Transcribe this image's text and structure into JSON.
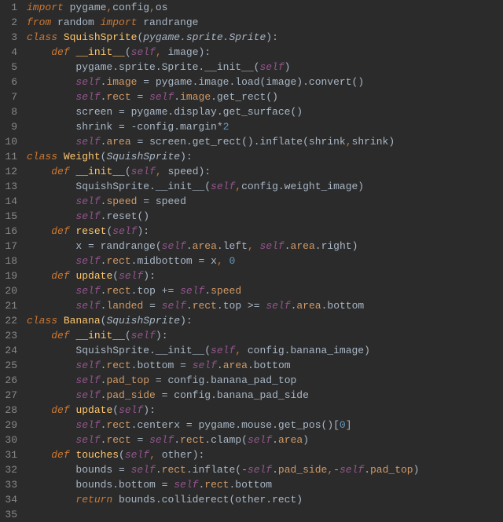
{
  "lines": [
    {
      "n": 1,
      "tokens": [
        {
          "t": "import ",
          "c": "kw"
        },
        {
          "t": "pygame",
          "c": "id"
        },
        {
          "t": ",",
          "c": "comma"
        },
        {
          "t": "config",
          "c": "id"
        },
        {
          "t": ",",
          "c": "comma"
        },
        {
          "t": "os",
          "c": "id"
        }
      ]
    },
    {
      "n": 2,
      "tokens": [
        {
          "t": "from ",
          "c": "kw"
        },
        {
          "t": "random ",
          "c": "id"
        },
        {
          "t": "import ",
          "c": "kw"
        },
        {
          "t": "randrange",
          "c": "id"
        }
      ]
    },
    {
      "n": 3,
      "tokens": [
        {
          "t": "class ",
          "c": "kw"
        },
        {
          "t": "SquishSprite",
          "c": "classname"
        },
        {
          "t": "(",
          "c": "paren"
        },
        {
          "t": "pygame.sprite.Sprite",
          "c": "base"
        },
        {
          "t": "):",
          "c": "paren"
        }
      ]
    },
    {
      "n": 4,
      "tokens": [
        {
          "t": "    ",
          "c": "id"
        },
        {
          "t": "def ",
          "c": "kw"
        },
        {
          "t": "__init__",
          "c": "def"
        },
        {
          "t": "(",
          "c": "paren"
        },
        {
          "t": "self",
          "c": "self"
        },
        {
          "t": ", ",
          "c": "comma"
        },
        {
          "t": "image",
          "c": "id"
        },
        {
          "t": "):",
          "c": "paren"
        }
      ]
    },
    {
      "n": 5,
      "tokens": [
        {
          "t": "        pygame.sprite.Sprite.__init__(",
          "c": "id"
        },
        {
          "t": "self",
          "c": "self"
        },
        {
          "t": ")",
          "c": "paren"
        }
      ]
    },
    {
      "n": 6,
      "tokens": [
        {
          "t": "        ",
          "c": "id"
        },
        {
          "t": "self",
          "c": "self"
        },
        {
          "t": ".",
          "c": "op"
        },
        {
          "t": "image",
          "c": "prop"
        },
        {
          "t": " = pygame.image.load(image).convert()",
          "c": "id"
        }
      ]
    },
    {
      "n": 7,
      "tokens": [
        {
          "t": "        ",
          "c": "id"
        },
        {
          "t": "self",
          "c": "self"
        },
        {
          "t": ".",
          "c": "op"
        },
        {
          "t": "rect",
          "c": "prop"
        },
        {
          "t": " = ",
          "c": "id"
        },
        {
          "t": "self",
          "c": "self"
        },
        {
          "t": ".",
          "c": "op"
        },
        {
          "t": "image",
          "c": "prop"
        },
        {
          "t": ".get_rect()",
          "c": "id"
        }
      ]
    },
    {
      "n": 8,
      "tokens": [
        {
          "t": "        screen = pygame.display.get_surface()",
          "c": "id"
        }
      ]
    },
    {
      "n": 9,
      "tokens": [
        {
          "t": "        shrink = -config.margin*",
          "c": "id"
        },
        {
          "t": "2",
          "c": "num"
        }
      ]
    },
    {
      "n": 10,
      "tokens": [
        {
          "t": "        ",
          "c": "id"
        },
        {
          "t": "self",
          "c": "self"
        },
        {
          "t": ".",
          "c": "op"
        },
        {
          "t": "area",
          "c": "prop"
        },
        {
          "t": " = screen.get_rect().inflate(shrink",
          "c": "id"
        },
        {
          "t": ",",
          "c": "comma"
        },
        {
          "t": "shrink)",
          "c": "id"
        }
      ]
    },
    {
      "n": 11,
      "tokens": [
        {
          "t": "class ",
          "c": "kw"
        },
        {
          "t": "Weight",
          "c": "classname"
        },
        {
          "t": "(",
          "c": "paren"
        },
        {
          "t": "SquishSprite",
          "c": "base"
        },
        {
          "t": "):",
          "c": "paren"
        }
      ]
    },
    {
      "n": 12,
      "tokens": [
        {
          "t": "    ",
          "c": "id"
        },
        {
          "t": "def ",
          "c": "kw"
        },
        {
          "t": "__init__",
          "c": "def"
        },
        {
          "t": "(",
          "c": "paren"
        },
        {
          "t": "self",
          "c": "self"
        },
        {
          "t": ", ",
          "c": "comma"
        },
        {
          "t": "speed",
          "c": "id"
        },
        {
          "t": "):",
          "c": "paren"
        }
      ]
    },
    {
      "n": 13,
      "tokens": [
        {
          "t": "        SquishSprite.__init__(",
          "c": "id"
        },
        {
          "t": "self",
          "c": "self"
        },
        {
          "t": ",",
          "c": "comma"
        },
        {
          "t": "config.weight_image)",
          "c": "id"
        }
      ]
    },
    {
      "n": 14,
      "tokens": [
        {
          "t": "        ",
          "c": "id"
        },
        {
          "t": "self",
          "c": "self"
        },
        {
          "t": ".",
          "c": "op"
        },
        {
          "t": "speed",
          "c": "prop"
        },
        {
          "t": " = speed",
          "c": "id"
        }
      ]
    },
    {
      "n": 15,
      "tokens": [
        {
          "t": "        ",
          "c": "id"
        },
        {
          "t": "self",
          "c": "self"
        },
        {
          "t": ".reset()",
          "c": "id"
        }
      ]
    },
    {
      "n": 16,
      "tokens": [
        {
          "t": "    ",
          "c": "id"
        },
        {
          "t": "def ",
          "c": "kw"
        },
        {
          "t": "reset",
          "c": "def"
        },
        {
          "t": "(",
          "c": "paren"
        },
        {
          "t": "self",
          "c": "self"
        },
        {
          "t": "):",
          "c": "paren"
        }
      ]
    },
    {
      "n": 17,
      "tokens": [
        {
          "t": "        x = randrange(",
          "c": "id"
        },
        {
          "t": "self",
          "c": "self"
        },
        {
          "t": ".",
          "c": "op"
        },
        {
          "t": "area",
          "c": "prop"
        },
        {
          "t": ".left",
          "c": "id"
        },
        {
          "t": ", ",
          "c": "comma"
        },
        {
          "t": "self",
          "c": "self"
        },
        {
          "t": ".",
          "c": "op"
        },
        {
          "t": "area",
          "c": "prop"
        },
        {
          "t": ".right)",
          "c": "id"
        }
      ]
    },
    {
      "n": 18,
      "tokens": [
        {
          "t": "        ",
          "c": "id"
        },
        {
          "t": "self",
          "c": "self"
        },
        {
          "t": ".",
          "c": "op"
        },
        {
          "t": "rect",
          "c": "prop"
        },
        {
          "t": ".midbottom = x",
          "c": "id"
        },
        {
          "t": ", ",
          "c": "comma"
        },
        {
          "t": "0",
          "c": "num"
        }
      ]
    },
    {
      "n": 19,
      "tokens": [
        {
          "t": "    ",
          "c": "id"
        },
        {
          "t": "def ",
          "c": "kw"
        },
        {
          "t": "update",
          "c": "def"
        },
        {
          "t": "(",
          "c": "paren"
        },
        {
          "t": "self",
          "c": "self"
        },
        {
          "t": "):",
          "c": "paren"
        }
      ]
    },
    {
      "n": 20,
      "tokens": [
        {
          "t": "        ",
          "c": "id"
        },
        {
          "t": "self",
          "c": "self"
        },
        {
          "t": ".",
          "c": "op"
        },
        {
          "t": "rect",
          "c": "prop"
        },
        {
          "t": ".top += ",
          "c": "id"
        },
        {
          "t": "self",
          "c": "self"
        },
        {
          "t": ".",
          "c": "op"
        },
        {
          "t": "speed",
          "c": "prop"
        }
      ]
    },
    {
      "n": 21,
      "tokens": [
        {
          "t": "        ",
          "c": "id"
        },
        {
          "t": "self",
          "c": "self"
        },
        {
          "t": ".",
          "c": "op"
        },
        {
          "t": "landed",
          "c": "prop"
        },
        {
          "t": " = ",
          "c": "id"
        },
        {
          "t": "self",
          "c": "self"
        },
        {
          "t": ".",
          "c": "op"
        },
        {
          "t": "rect",
          "c": "prop"
        },
        {
          "t": ".top >= ",
          "c": "id"
        },
        {
          "t": "self",
          "c": "self"
        },
        {
          "t": ".",
          "c": "op"
        },
        {
          "t": "area",
          "c": "prop"
        },
        {
          "t": ".bottom",
          "c": "id"
        }
      ]
    },
    {
      "n": 22,
      "tokens": [
        {
          "t": "class ",
          "c": "kw"
        },
        {
          "t": "Banana",
          "c": "classname"
        },
        {
          "t": "(",
          "c": "paren"
        },
        {
          "t": "SquishSprite",
          "c": "base"
        },
        {
          "t": "):",
          "c": "paren"
        }
      ]
    },
    {
      "n": 23,
      "tokens": [
        {
          "t": "    ",
          "c": "id"
        },
        {
          "t": "def ",
          "c": "kw"
        },
        {
          "t": "__init__",
          "c": "def"
        },
        {
          "t": "(",
          "c": "paren"
        },
        {
          "t": "self",
          "c": "self"
        },
        {
          "t": "):",
          "c": "paren"
        }
      ]
    },
    {
      "n": 24,
      "tokens": [
        {
          "t": "        SquishSprite.__init__(",
          "c": "id"
        },
        {
          "t": "self",
          "c": "self"
        },
        {
          "t": ", ",
          "c": "comma"
        },
        {
          "t": "config.banana_image)",
          "c": "id"
        }
      ]
    },
    {
      "n": 25,
      "tokens": [
        {
          "t": "        ",
          "c": "id"
        },
        {
          "t": "self",
          "c": "self"
        },
        {
          "t": ".",
          "c": "op"
        },
        {
          "t": "rect",
          "c": "prop"
        },
        {
          "t": ".bottom = ",
          "c": "id"
        },
        {
          "t": "self",
          "c": "self"
        },
        {
          "t": ".",
          "c": "op"
        },
        {
          "t": "area",
          "c": "prop"
        },
        {
          "t": ".bottom",
          "c": "id"
        }
      ]
    },
    {
      "n": 26,
      "tokens": [
        {
          "t": "        ",
          "c": "id"
        },
        {
          "t": "self",
          "c": "self"
        },
        {
          "t": ".",
          "c": "op"
        },
        {
          "t": "pad_top",
          "c": "prop"
        },
        {
          "t": " = config.banana_pad_top",
          "c": "id"
        }
      ]
    },
    {
      "n": 27,
      "tokens": [
        {
          "t": "        ",
          "c": "id"
        },
        {
          "t": "self",
          "c": "self"
        },
        {
          "t": ".",
          "c": "op"
        },
        {
          "t": "pad_side",
          "c": "prop"
        },
        {
          "t": " = config.banana_pad_side",
          "c": "id"
        }
      ]
    },
    {
      "n": 28,
      "tokens": [
        {
          "t": "    ",
          "c": "id"
        },
        {
          "t": "def ",
          "c": "kw"
        },
        {
          "t": "update",
          "c": "def"
        },
        {
          "t": "(",
          "c": "paren"
        },
        {
          "t": "self",
          "c": "self"
        },
        {
          "t": "):",
          "c": "paren"
        }
      ]
    },
    {
      "n": 29,
      "tokens": [
        {
          "t": "        ",
          "c": "id"
        },
        {
          "t": "self",
          "c": "self"
        },
        {
          "t": ".",
          "c": "op"
        },
        {
          "t": "rect",
          "c": "prop"
        },
        {
          "t": ".centerx = pygame.mouse.get_pos()[",
          "c": "id"
        },
        {
          "t": "0",
          "c": "num"
        },
        {
          "t": "]",
          "c": "id"
        }
      ]
    },
    {
      "n": 30,
      "tokens": [
        {
          "t": "        ",
          "c": "id"
        },
        {
          "t": "self",
          "c": "self"
        },
        {
          "t": ".",
          "c": "op"
        },
        {
          "t": "rect",
          "c": "prop"
        },
        {
          "t": " = ",
          "c": "id"
        },
        {
          "t": "self",
          "c": "self"
        },
        {
          "t": ".",
          "c": "op"
        },
        {
          "t": "rect",
          "c": "prop"
        },
        {
          "t": ".clamp(",
          "c": "id"
        },
        {
          "t": "self",
          "c": "self"
        },
        {
          "t": ".",
          "c": "op"
        },
        {
          "t": "area",
          "c": "prop"
        },
        {
          "t": ")",
          "c": "paren"
        }
      ]
    },
    {
      "n": 31,
      "tokens": [
        {
          "t": "    ",
          "c": "id"
        },
        {
          "t": "def ",
          "c": "kw"
        },
        {
          "t": "touches",
          "c": "def"
        },
        {
          "t": "(",
          "c": "paren"
        },
        {
          "t": "self",
          "c": "self"
        },
        {
          "t": ", ",
          "c": "comma"
        },
        {
          "t": "other",
          "c": "id"
        },
        {
          "t": "):",
          "c": "paren"
        }
      ]
    },
    {
      "n": 32,
      "tokens": [
        {
          "t": "        bounds = ",
          "c": "id"
        },
        {
          "t": "self",
          "c": "self"
        },
        {
          "t": ".",
          "c": "op"
        },
        {
          "t": "rect",
          "c": "prop"
        },
        {
          "t": ".inflate(-",
          "c": "id"
        },
        {
          "t": "self",
          "c": "self"
        },
        {
          "t": ".",
          "c": "op"
        },
        {
          "t": "pad_side",
          "c": "prop"
        },
        {
          "t": ",",
          "c": "comma"
        },
        {
          "t": "-",
          "c": "id"
        },
        {
          "t": "self",
          "c": "self"
        },
        {
          "t": ".",
          "c": "op"
        },
        {
          "t": "pad_top",
          "c": "prop"
        },
        {
          "t": ")",
          "c": "paren"
        }
      ]
    },
    {
      "n": 33,
      "tokens": [
        {
          "t": "        bounds.bottom = ",
          "c": "id"
        },
        {
          "t": "self",
          "c": "self"
        },
        {
          "t": ".",
          "c": "op"
        },
        {
          "t": "rect",
          "c": "prop"
        },
        {
          "t": ".bottom",
          "c": "id"
        }
      ]
    },
    {
      "n": 34,
      "tokens": [
        {
          "t": "        ",
          "c": "id"
        },
        {
          "t": "return ",
          "c": "kw"
        },
        {
          "t": "bounds.colliderect(other.rect)",
          "c": "id"
        }
      ]
    },
    {
      "n": 35,
      "tokens": []
    }
  ]
}
